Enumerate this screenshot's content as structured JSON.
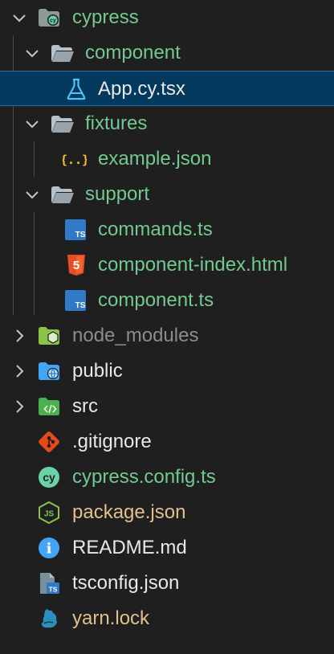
{
  "explorer": {
    "items": [
      {
        "label": "cypress",
        "icon": "cypress-folder-icon",
        "expanded": true
      },
      {
        "label": "component",
        "icon": "folder-open-icon",
        "expanded": true
      },
      {
        "label": "App.cy.tsx",
        "icon": "flask-test-icon",
        "selected": true
      },
      {
        "label": "fixtures",
        "icon": "folder-open-icon",
        "expanded": true
      },
      {
        "label": "example.json",
        "icon": "json-braces-icon"
      },
      {
        "label": "support",
        "icon": "folder-open-icon",
        "expanded": true
      },
      {
        "label": "commands.ts",
        "icon": "typescript-icon"
      },
      {
        "label": "component-index.html",
        "icon": "html5-icon"
      },
      {
        "label": "component.ts",
        "icon": "typescript-icon"
      },
      {
        "label": "node_modules",
        "icon": "node-folder-icon",
        "expanded": false
      },
      {
        "label": "public",
        "icon": "public-folder-icon",
        "expanded": false
      },
      {
        "label": "src",
        "icon": "src-folder-icon",
        "expanded": false
      },
      {
        "label": ".gitignore",
        "icon": "git-icon"
      },
      {
        "label": "cypress.config.ts",
        "icon": "cypress-icon"
      },
      {
        "label": "package.json",
        "icon": "nodejs-icon"
      },
      {
        "label": "README.md",
        "icon": "info-icon"
      },
      {
        "label": "tsconfig.json",
        "icon": "tsconfig-icon"
      },
      {
        "label": "yarn.lock",
        "icon": "yarn-icon"
      }
    ]
  },
  "icon_glyphs": {
    "ts": "TS",
    "cy": "cy",
    "js": "JS",
    "braces": "{..}",
    "info": "i",
    "html": "5"
  },
  "colors": {
    "background": "#1f1f1f",
    "selection": "#04395e",
    "selection_border": "#1a6fb0",
    "modified_green": "#73c991",
    "ignored_gray": "#8c8c8c",
    "untracked_yellow": "#e2c08d",
    "folder": "#c5c5c5",
    "typescript": "#3178c6",
    "html5": "#e44d26",
    "git": "#e64a19",
    "cypress": "#69d3a7",
    "nodejs": "#8bc34a",
    "info": "#42a5f5",
    "yarn": "#2c8ebb"
  }
}
